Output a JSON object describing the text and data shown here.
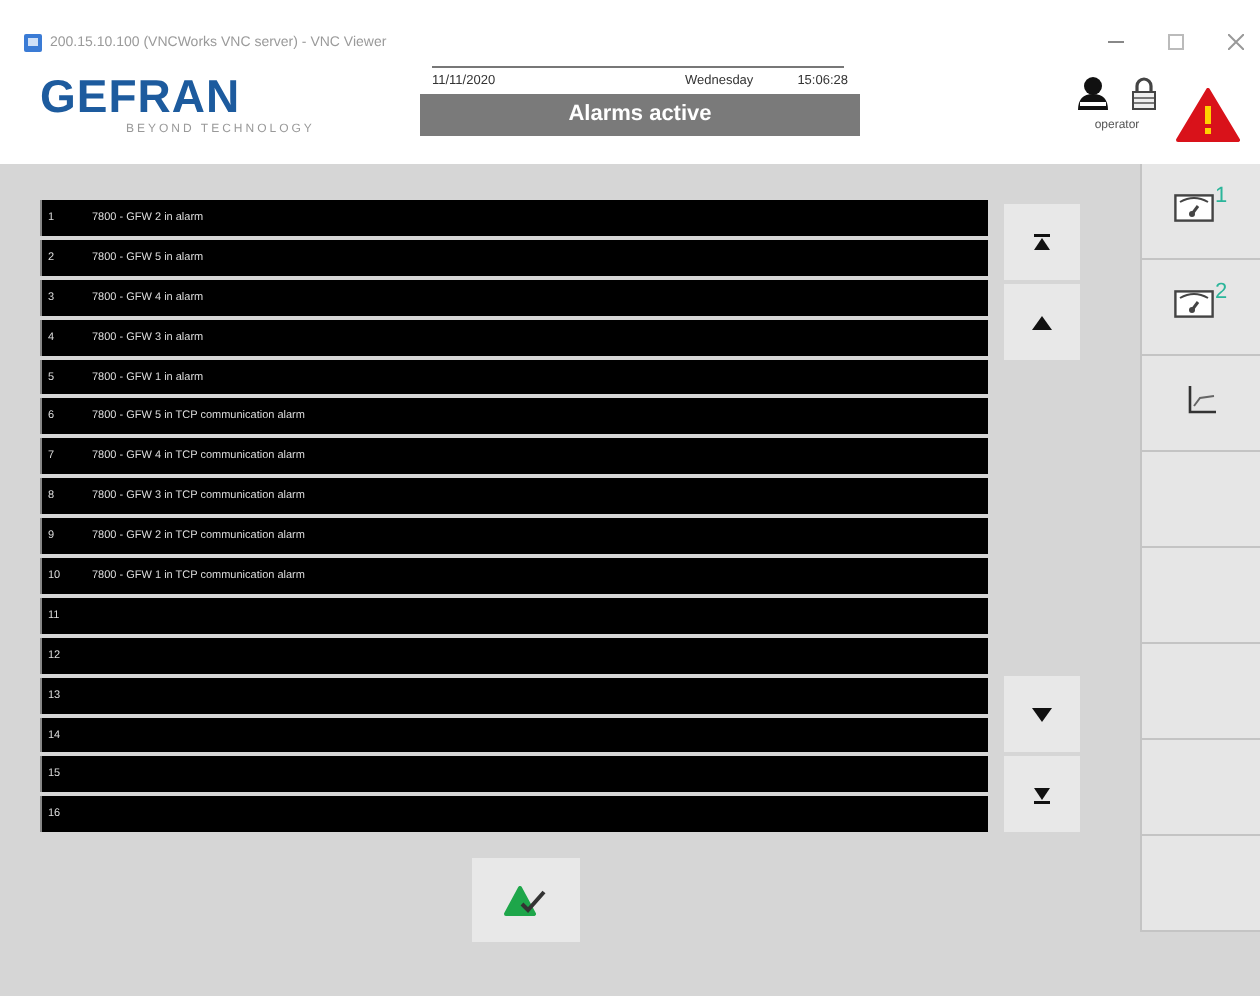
{
  "window": {
    "title": "200.15.10.100 (VNCWorks VNC server) - VNC Viewer"
  },
  "header": {
    "logo": "GEFRAN",
    "tagline": "BEYOND TECHNOLOGY",
    "date": "11/11/2020",
    "weekday": "Wednesday",
    "time": "15:06:28",
    "status": "Alarms active",
    "user": "operator"
  },
  "alarms": [
    {
      "number": "1",
      "message": "7800 - GFW 2 in alarm"
    },
    {
      "number": "2",
      "message": "7800 - GFW 5 in alarm"
    },
    {
      "number": "3",
      "message": "7800 - GFW 4 in alarm"
    },
    {
      "number": "4",
      "message": "7800 - GFW 3 in alarm"
    },
    {
      "number": "5",
      "message": "7800 - GFW 1 in alarm"
    },
    {
      "number": "6",
      "message": "7800 - GFW 5 in TCP communication alarm"
    },
    {
      "number": "7",
      "message": "7800 - GFW 4 in TCP communication alarm"
    },
    {
      "number": "8",
      "message": "7800 - GFW 3 in TCP communication alarm"
    },
    {
      "number": "9",
      "message": "7800 - GFW 2 in TCP communication alarm"
    },
    {
      "number": "10",
      "message": "7800 - GFW 1 in TCP communication alarm"
    },
    {
      "number": "11"
    },
    {
      "number": "12"
    },
    {
      "number": "13"
    },
    {
      "number": "14"
    },
    {
      "number": "15"
    },
    {
      "number": "16"
    }
  ],
  "sidebar": [
    {
      "kind": "screen",
      "label": "1"
    },
    {
      "kind": "screen",
      "label": "2"
    },
    {
      "kind": "chart"
    },
    {
      "kind": "blank"
    },
    {
      "kind": "blank"
    },
    {
      "kind": "blank"
    },
    {
      "kind": "blank"
    },
    {
      "kind": "blank"
    }
  ]
}
